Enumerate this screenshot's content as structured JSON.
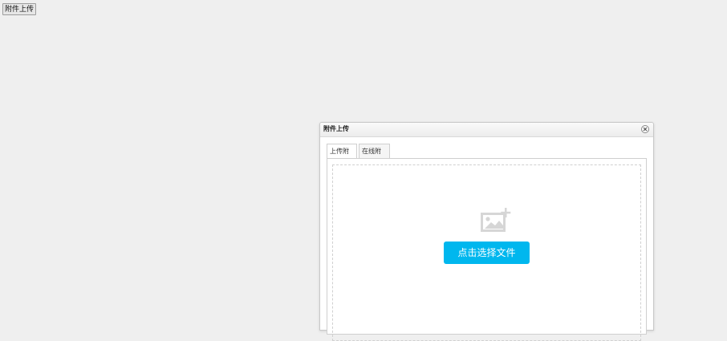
{
  "top_button": {
    "label": "附件上传"
  },
  "dialog": {
    "title": "附件上传",
    "tabs": [
      {
        "label": "上传附件",
        "active": true
      },
      {
        "label": "在线附件",
        "active": false
      }
    ],
    "upload": {
      "button_label": "点击选择文件",
      "icon": "image-add-icon"
    }
  },
  "colors": {
    "primary_button": "#00b7ee",
    "background": "#efefef"
  }
}
